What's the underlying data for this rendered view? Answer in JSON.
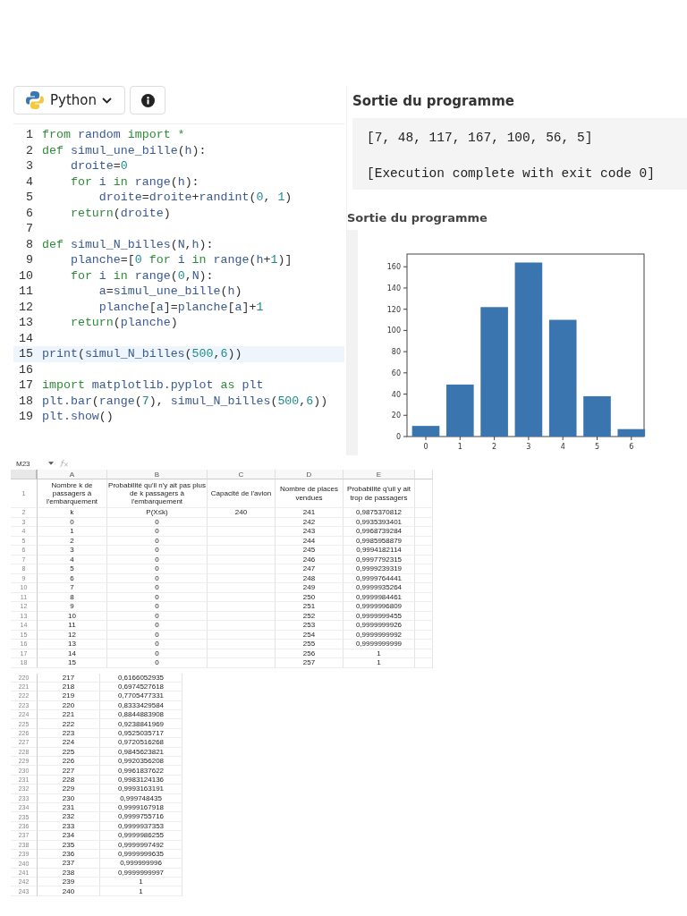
{
  "toolbar": {
    "language": "Python"
  },
  "editor": {
    "lines": [
      {
        "number": "1",
        "selected": false,
        "tokens": [
          {
            "text": "from ",
            "kind": "kw"
          },
          {
            "text": "random ",
            "kind": "id"
          },
          {
            "text": "import *",
            "kind": "kw"
          }
        ]
      },
      {
        "number": "2",
        "selected": false,
        "tokens": [
          {
            "text": "def ",
            "kind": "kw"
          },
          {
            "text": "simul_une_bille",
            "kind": "id"
          },
          {
            "text": "(",
            "kind": "op"
          },
          {
            "text": "h",
            "kind": "id"
          },
          {
            "text": "):",
            "kind": "op"
          }
        ]
      },
      {
        "number": "3",
        "selected": false,
        "tokens": [
          {
            "text": "    droite",
            "kind": "id"
          },
          {
            "text": "=",
            "kind": "op"
          },
          {
            "text": "0",
            "kind": "num"
          }
        ]
      },
      {
        "number": "4",
        "selected": false,
        "tokens": [
          {
            "text": "    for ",
            "kind": "kw"
          },
          {
            "text": "i ",
            "kind": "id"
          },
          {
            "text": "in ",
            "kind": "kw"
          },
          {
            "text": "range",
            "kind": "id"
          },
          {
            "text": "(",
            "kind": "op"
          },
          {
            "text": "h",
            "kind": "id"
          },
          {
            "text": "):",
            "kind": "op"
          }
        ]
      },
      {
        "number": "5",
        "selected": false,
        "tokens": [
          {
            "text": "        droite",
            "kind": "id"
          },
          {
            "text": "=",
            "kind": "op"
          },
          {
            "text": "droite",
            "kind": "id"
          },
          {
            "text": "+",
            "kind": "op"
          },
          {
            "text": "randint",
            "kind": "id"
          },
          {
            "text": "(",
            "kind": "op"
          },
          {
            "text": "0",
            "kind": "num"
          },
          {
            "text": ", ",
            "kind": "op"
          },
          {
            "text": "1",
            "kind": "num"
          },
          {
            "text": ")",
            "kind": "op"
          }
        ]
      },
      {
        "number": "6",
        "selected": false,
        "tokens": [
          {
            "text": "    return",
            "kind": "kw"
          },
          {
            "text": "(",
            "kind": "op"
          },
          {
            "text": "droite",
            "kind": "id"
          },
          {
            "text": ")",
            "kind": "op"
          }
        ]
      },
      {
        "number": "7",
        "selected": false
      },
      {
        "number": "8",
        "selected": false,
        "tokens": [
          {
            "text": "def ",
            "kind": "kw"
          },
          {
            "text": "simul_N_billes",
            "kind": "id"
          },
          {
            "text": "(",
            "kind": "op"
          },
          {
            "text": "N",
            "kind": "id"
          },
          {
            "text": ",",
            "kind": "op"
          },
          {
            "text": "h",
            "kind": "id"
          },
          {
            "text": "):",
            "kind": "op"
          }
        ]
      },
      {
        "number": "9",
        "selected": false,
        "tokens": [
          {
            "text": "    planche",
            "kind": "id"
          },
          {
            "text": "=[",
            "kind": "op"
          },
          {
            "text": "0 ",
            "kind": "num"
          },
          {
            "text": "for ",
            "kind": "kw"
          },
          {
            "text": "i ",
            "kind": "id"
          },
          {
            "text": "in ",
            "kind": "kw"
          },
          {
            "text": "range",
            "kind": "id"
          },
          {
            "text": "(",
            "kind": "op"
          },
          {
            "text": "h",
            "kind": "id"
          },
          {
            "text": "+",
            "kind": "op"
          },
          {
            "text": "1",
            "kind": "num"
          },
          {
            "text": ")]",
            "kind": "op"
          }
        ]
      },
      {
        "number": "10",
        "selected": false,
        "tokens": [
          {
            "text": "    for ",
            "kind": "kw"
          },
          {
            "text": "i ",
            "kind": "id"
          },
          {
            "text": "in ",
            "kind": "kw"
          },
          {
            "text": "range",
            "kind": "id"
          },
          {
            "text": "(",
            "kind": "op"
          },
          {
            "text": "0",
            "kind": "num"
          },
          {
            "text": ",",
            "kind": "op"
          },
          {
            "text": "N",
            "kind": "id"
          },
          {
            "text": "):",
            "kind": "op"
          }
        ]
      },
      {
        "number": "11",
        "selected": false,
        "tokens": [
          {
            "text": "        a",
            "kind": "id"
          },
          {
            "text": "=",
            "kind": "op"
          },
          {
            "text": "simul_une_bille",
            "kind": "id"
          },
          {
            "text": "(",
            "kind": "op"
          },
          {
            "text": "h",
            "kind": "id"
          },
          {
            "text": ")",
            "kind": "op"
          }
        ]
      },
      {
        "number": "12",
        "selected": false,
        "tokens": [
          {
            "text": "        planche",
            "kind": "id"
          },
          {
            "text": "[",
            "kind": "op"
          },
          {
            "text": "a",
            "kind": "id"
          },
          {
            "text": "]=",
            "kind": "op"
          },
          {
            "text": "planche",
            "kind": "id"
          },
          {
            "text": "[",
            "kind": "op"
          },
          {
            "text": "a",
            "kind": "id"
          },
          {
            "text": "]+",
            "kind": "op"
          },
          {
            "text": "1",
            "kind": "num"
          }
        ]
      },
      {
        "number": "13",
        "selected": false,
        "tokens": [
          {
            "text": "    return",
            "kind": "kw"
          },
          {
            "text": "(",
            "kind": "op"
          },
          {
            "text": "planche",
            "kind": "id"
          },
          {
            "text": ")",
            "kind": "op"
          }
        ]
      },
      {
        "number": "14",
        "selected": false
      },
      {
        "number": "15",
        "selected": true,
        "tokens": [
          {
            "text": "print",
            "kind": "id"
          },
          {
            "text": "(",
            "kind": "op"
          },
          {
            "text": "simul_N_billes",
            "kind": "id"
          },
          {
            "text": "(",
            "kind": "op"
          },
          {
            "text": "500",
            "kind": "num"
          },
          {
            "text": ",",
            "kind": "op"
          },
          {
            "text": "6",
            "kind": "num"
          },
          {
            "text": "))",
            "kind": "op"
          }
        ]
      },
      {
        "number": "16",
        "selected": false
      },
      {
        "number": "17",
        "selected": false,
        "tokens": [
          {
            "text": "import ",
            "kind": "kw"
          },
          {
            "text": "matplotlib.pyplot ",
            "kind": "id"
          },
          {
            "text": "as ",
            "kind": "kw"
          },
          {
            "text": "plt",
            "kind": "id"
          }
        ]
      },
      {
        "number": "18",
        "selected": false,
        "tokens": [
          {
            "text": "plt.bar",
            "kind": "id"
          },
          {
            "text": "(",
            "kind": "op"
          },
          {
            "text": "range",
            "kind": "id"
          },
          {
            "text": "(",
            "kind": "op"
          },
          {
            "text": "7",
            "kind": "num"
          },
          {
            "text": "), ",
            "kind": "op"
          },
          {
            "text": "simul_N_billes",
            "kind": "id"
          },
          {
            "text": "(",
            "kind": "op"
          },
          {
            "text": "500",
            "kind": "num"
          },
          {
            "text": ",",
            "kind": "op"
          },
          {
            "text": "6",
            "kind": "num"
          },
          {
            "text": "))",
            "kind": "op"
          }
        ]
      },
      {
        "number": "19",
        "selected": false,
        "tokens": [
          {
            "text": "plt.show",
            "kind": "id"
          },
          {
            "text": "()",
            "kind": "op"
          }
        ]
      }
    ]
  },
  "text_output": {
    "title": "Sortie du programme",
    "lines": [
      "[7, 48, 117, 167, 100, 56, 5]",
      "[Execution complete with exit code 0]"
    ]
  },
  "plot_output": {
    "title": "Sortie du programme",
    "chart_data": {
      "type": "bar",
      "categories": [
        "0",
        "1",
        "2",
        "3",
        "4",
        "5",
        "6"
      ],
      "values": [
        10,
        49,
        122,
        164,
        110,
        38,
        7
      ],
      "ylim": [
        0,
        172
      ],
      "yticks": [
        0,
        20,
        40,
        60,
        80,
        100,
        120,
        140,
        160
      ]
    }
  },
  "sheet": {
    "name_box": "M23",
    "columns": [
      "A",
      "B",
      "C",
      "D",
      "E"
    ],
    "rows": [
      {
        "number": "1",
        "header": true,
        "cells": [
          "Nombre k de passagers à l'embarquement",
          "Probabilité qu'il n'y ait pas plus de k passagers à l'embarquement",
          "Capacité de l'avion",
          "Nombre de places vendues",
          "Probabilité q'uil y ait trop de passagers"
        ]
      },
      {
        "number": "2",
        "header": false,
        "cells": [
          "k",
          "P(X≤k)",
          "240",
          "241",
          "0,9875370812"
        ]
      },
      {
        "number": "3",
        "header": false,
        "cells": [
          "0",
          "0",
          null,
          "242",
          "0,9935393401"
        ]
      },
      {
        "number": "4",
        "header": false,
        "cells": [
          "1",
          "0",
          null,
          "243",
          "0,9968739284"
        ]
      },
      {
        "number": "5",
        "header": false,
        "cells": [
          "2",
          "0",
          null,
          "244",
          "0,9985958879"
        ]
      },
      {
        "number": "6",
        "header": false,
        "cells": [
          "3",
          "0",
          null,
          "245",
          "0,9994182114"
        ]
      },
      {
        "number": "7",
        "header": false,
        "cells": [
          "4",
          "0",
          null,
          "246",
          "0,9997792315"
        ]
      },
      {
        "number": "8",
        "header": false,
        "cells": [
          "5",
          "0",
          null,
          "247",
          "0,9999239319"
        ]
      },
      {
        "number": "9",
        "header": false,
        "cells": [
          "6",
          "0",
          null,
          "248",
          "0,9999764441"
        ]
      },
      {
        "number": "10",
        "header": false,
        "cells": [
          "7",
          "0",
          null,
          "249",
          "0,9999935264"
        ]
      },
      {
        "number": "11",
        "header": false,
        "cells": [
          "8",
          "0",
          null,
          "250",
          "0,9999984461"
        ]
      },
      {
        "number": "12",
        "header": false,
        "cells": [
          "9",
          "0",
          null,
          "251",
          "0,9999996809"
        ]
      },
      {
        "number": "13",
        "header": false,
        "cells": [
          "10",
          "0",
          null,
          "252",
          "0,9999999455"
        ]
      },
      {
        "number": "14",
        "header": false,
        "cells": [
          "11",
          "0",
          null,
          "253",
          "0,9999999926"
        ]
      },
      {
        "number": "15",
        "header": false,
        "cells": [
          "12",
          "0",
          null,
          "254",
          "0,9999999992"
        ]
      },
      {
        "number": "16",
        "header": false,
        "cells": [
          "13",
          "0",
          null,
          "255",
          "0,9999999999"
        ]
      },
      {
        "number": "17",
        "header": false,
        "cells": [
          "14",
          "0",
          null,
          "256",
          "1"
        ]
      },
      {
        "number": "18",
        "header": false,
        "cells": [
          "15",
          "0",
          null,
          "257",
          "1"
        ]
      }
    ]
  },
  "sheet_2": {
    "rows": [
      {
        "number": "220",
        "cells": [
          "217",
          "0,6166052935"
        ]
      },
      {
        "number": "221",
        "cells": [
          "218",
          "0,6974527618"
        ]
      },
      {
        "number": "222",
        "cells": [
          "219",
          "0,7705477331"
        ]
      },
      {
        "number": "223",
        "cells": [
          "220",
          "0,8333429584"
        ]
      },
      {
        "number": "224",
        "cells": [
          "221",
          "0,8844883908"
        ]
      },
      {
        "number": "225",
        "cells": [
          "222",
          "0,9238841969"
        ]
      },
      {
        "number": "226",
        "cells": [
          "223",
          "0,9525035717"
        ]
      },
      {
        "number": "227",
        "cells": [
          "224",
          "0,9720516268"
        ]
      },
      {
        "number": "228",
        "cells": [
          "225",
          "0,9845623821"
        ]
      },
      {
        "number": "229",
        "cells": [
          "226",
          "0,9920356208"
        ]
      },
      {
        "number": "230",
        "cells": [
          "227",
          "0,9961837622"
        ]
      },
      {
        "number": "231",
        "cells": [
          "228",
          "0,9983124136"
        ]
      },
      {
        "number": "232",
        "cells": [
          "229",
          "0,9993163191"
        ]
      },
      {
        "number": "233",
        "cells": [
          "230",
          "0,999748435"
        ]
      },
      {
        "number": "234",
        "cells": [
          "231",
          "0,9999167918"
        ]
      },
      {
        "number": "235",
        "cells": [
          "232",
          "0,9999755716"
        ]
      },
      {
        "number": "236",
        "cells": [
          "233",
          "0,9999937353"
        ]
      },
      {
        "number": "237",
        "cells": [
          "234",
          "0,9999986255"
        ]
      },
      {
        "number": "238",
        "cells": [
          "235",
          "0,9999997492"
        ]
      },
      {
        "number": "239",
        "cells": [
          "236",
          "0,9999999635"
        ]
      },
      {
        "number": "240",
        "cells": [
          "237",
          "0,999999996"
        ]
      },
      {
        "number": "241",
        "cells": [
          "238",
          "0,9999999997"
        ]
      },
      {
        "number": "242",
        "cells": [
          "239",
          "1"
        ]
      },
      {
        "number": "243",
        "cells": [
          "240",
          "1"
        ]
      }
    ]
  }
}
